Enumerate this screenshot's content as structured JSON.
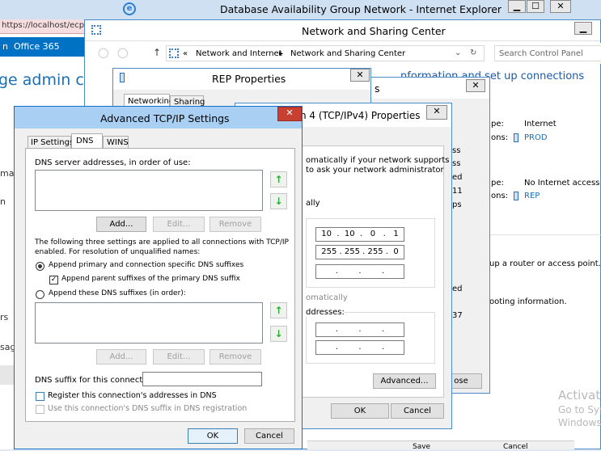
{
  "ie": {
    "title": "Database Availability Group Network - Internet Explorer",
    "address": "https://localhost/ecp/",
    "tab_office": "Office 365",
    "page_heading": "ge admin cer",
    "left_fragments": [
      "ma",
      "n",
      "rs",
      "sag"
    ]
  },
  "nsc": {
    "title": "Network and Sharing Center",
    "breadcrumb_prefix": "«",
    "breadcrumb_1": "Network and Internet",
    "breadcrumb_sep": "▸",
    "breadcrumb_2": "Network and Sharing Center",
    "search_placeholder": "Search Control Panel",
    "heading_fragment": "nformation and set up connections",
    "type_label_1": "pe:",
    "type_value_1": "Internet",
    "conn_label_1": "ons:",
    "conn_value_1": "PROD",
    "type_label_2": "pe:",
    "type_value_2": "No Internet access",
    "conn_label_2": "ons:",
    "conn_value_2": "REP",
    "setup_fragment": "up a router or access point.",
    "troubleshoot_fragment": "ooting information.",
    "status_fragments": [
      "ss",
      "ss",
      "ed",
      "11",
      "ps"
    ],
    "detail_fragments": [
      "ed",
      "37"
    ],
    "close_fragment": "ose",
    "bottom_fragments": [
      "Save",
      "Cancel"
    ]
  },
  "rep": {
    "title": "REP Properties",
    "title_fragment": "s",
    "tab_networking": "Networking",
    "tab_sharing": "Sharing"
  },
  "ipv4": {
    "title_fragment": "n 4 (TCP/IPv4) Properties",
    "desc_line1": "omatically if your network supports",
    "desc_line2": "to ask your network administrator",
    "ally": "ally",
    "ip_address": "10  .  10  .   0   .   1",
    "subnet_mask": "255 . 255 . 255 .  0",
    "gateway": ".        .        .",
    "omatically": "omatically",
    "addresses_label": "ddresses:",
    "dns1": ".        .        .",
    "dns2": ".        .        .",
    "advanced_label": "Advanced...",
    "ok_label": "OK",
    "cancel_label": "Cancel"
  },
  "adv": {
    "title": "Advanced TCP/IP Settings",
    "tabs": [
      "IP Settings",
      "DNS",
      "WINS"
    ],
    "dns_servers_label": "DNS server addresses, in order of use:",
    "add_label": "Add...",
    "edit_label": "Edit...",
    "remove_label": "Remove",
    "info_line1": "The following three settings are applied to all connections with TCP/IP",
    "info_line2": "enabled. For resolution of unqualified names:",
    "radio_primary": "Append primary and connection specific DNS suffixes",
    "check_parent": "Append parent suffixes of the primary DNS suffix",
    "radio_these": "Append these DNS suffixes (in order):",
    "suffix_label": "DNS suffix for this connection:",
    "suffix_value": "",
    "register_label": "Register this connection's addresses in DNS",
    "use_suffix_label": "Use this connection's DNS suffix in DNS registration",
    "ok_label": "OK",
    "cancel_label": "Cancel"
  },
  "desktop": {
    "activate_1": "Activat",
    "activate_2": "Go to Sys",
    "activate_3": "Windows"
  },
  "colors": {
    "accent": "#1a6fb5",
    "title_bar": "#b8d4f0",
    "close_red": "#c84031"
  }
}
